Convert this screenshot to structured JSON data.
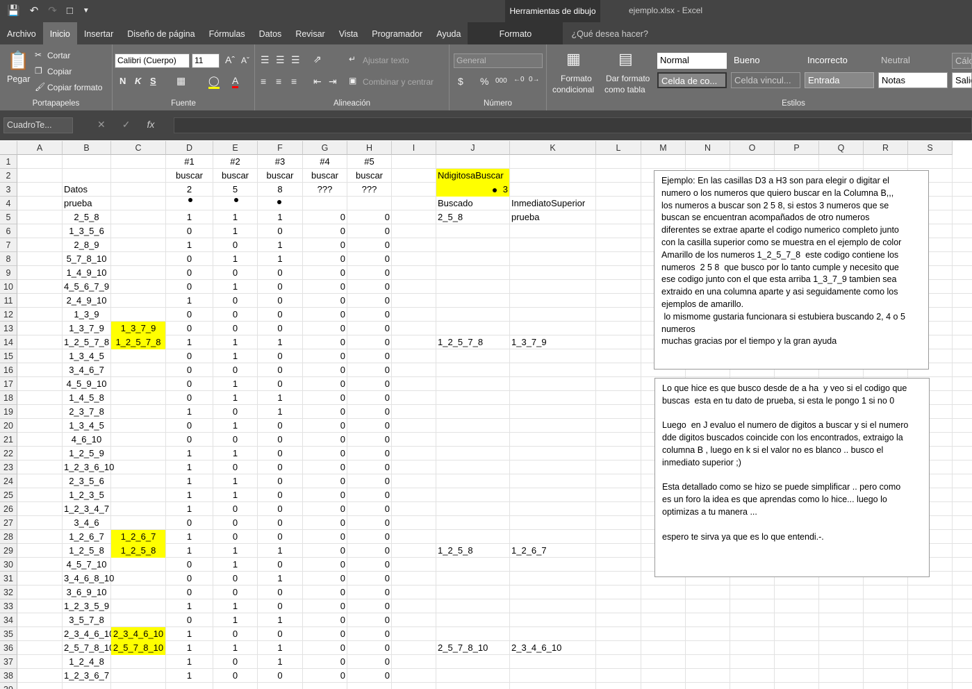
{
  "titlebar": {
    "context_tab": "Herramientas de dibujo",
    "doc_title": "ejemplo.xlsx  -  Excel"
  },
  "tabs": [
    "Archivo",
    "Inicio",
    "Insertar",
    "Diseño de página",
    "Fórmulas",
    "Datos",
    "Revisar",
    "Vista",
    "Programador",
    "Ayuda"
  ],
  "format_tab": "Formato",
  "tellme": "¿Qué desea hacer?",
  "ribbon": {
    "clipboard": {
      "paste": "Pegar",
      "cut": "Cortar",
      "copy": "Copiar",
      "format_painter": "Copiar formato",
      "label": "Portapapeles"
    },
    "font": {
      "name": "Calibri (Cuerpo)",
      "size": "11",
      "bold": "N",
      "italic": "K",
      "underline": "S",
      "label": "Fuente"
    },
    "alignment": {
      "wrap": "Ajustar texto",
      "merge": "Combinar y centrar",
      "label": "Alineación"
    },
    "number": {
      "format": "General",
      "currency": "$",
      "percent": "%",
      "thousands": "000",
      "label": "Número"
    },
    "styles": {
      "cond_format": [
        "Formato",
        "condicional"
      ],
      "table_format": [
        "Dar formato",
        "como tabla"
      ],
      "cells_row1": [
        "Normal",
        "Bueno",
        "Incorrecto",
        "Neutral",
        "Cálc"
      ],
      "cells_row2": [
        "Celda de co...",
        "Celda vincul...",
        "Entrada",
        "Notas",
        "Salid"
      ],
      "label": "Estilos"
    }
  },
  "formula_bar": {
    "name_box": "CuadroTe...",
    "fx": "fx"
  },
  "columns": [
    "A",
    "B",
    "C",
    "D",
    "E",
    "F",
    "G",
    "H",
    "I",
    "J",
    "K",
    "L",
    "M",
    "N",
    "O",
    "P",
    "Q",
    "R",
    "S"
  ],
  "header_rows": {
    "row1": [
      "#1",
      "#2",
      "#3",
      "#4",
      "#5"
    ],
    "row2": [
      "buscar",
      "buscar",
      "buscar",
      "buscar",
      "buscar"
    ],
    "row3": [
      "2",
      "5",
      "8",
      "???",
      "???"
    ],
    "b3": "Datos",
    "b4": "prueba",
    "j2": "NdigitosaBuscar",
    "j3": "3",
    "j4": "Buscado",
    "k4": "InmediatoSuperior"
  },
  "data_rows": [
    {
      "b": "2_5_8",
      "c": "",
      "d": 1,
      "e": 1,
      "f": 1,
      "g": 0,
      "h": 0,
      "j": "2_5_8",
      "k": "prueba"
    },
    {
      "b": "1_3_5_6",
      "c": "",
      "d": 0,
      "e": 1,
      "f": 0,
      "g": 0,
      "h": 0,
      "j": "",
      "k": ""
    },
    {
      "b": "2_8_9",
      "c": "",
      "d": 1,
      "e": 0,
      "f": 1,
      "g": 0,
      "h": 0,
      "j": "",
      "k": ""
    },
    {
      "b": "5_7_8_10",
      "c": "",
      "d": 0,
      "e": 1,
      "f": 1,
      "g": 0,
      "h": 0,
      "j": "",
      "k": ""
    },
    {
      "b": "1_4_9_10",
      "c": "",
      "d": 0,
      "e": 0,
      "f": 0,
      "g": 0,
      "h": 0,
      "j": "",
      "k": ""
    },
    {
      "b": "4_5_6_7_9",
      "c": "",
      "d": 0,
      "e": 1,
      "f": 0,
      "g": 0,
      "h": 0,
      "j": "",
      "k": ""
    },
    {
      "b": "2_4_9_10",
      "c": "",
      "d": 1,
      "e": 0,
      "f": 0,
      "g": 0,
      "h": 0,
      "j": "",
      "k": ""
    },
    {
      "b": "1_3_9",
      "c": "",
      "d": 0,
      "e": 0,
      "f": 0,
      "g": 0,
      "h": 0,
      "j": "",
      "k": ""
    },
    {
      "b": "1_3_7_9",
      "c": "1_3_7_9",
      "d": 0,
      "e": 0,
      "f": 0,
      "g": 0,
      "h": 0,
      "j": "",
      "k": ""
    },
    {
      "b": "1_2_5_7_8",
      "c": "1_2_5_7_8",
      "d": 1,
      "e": 1,
      "f": 1,
      "g": 0,
      "h": 0,
      "j": "1_2_5_7_8",
      "k": "1_3_7_9"
    },
    {
      "b": "1_3_4_5",
      "c": "",
      "d": 0,
      "e": 1,
      "f": 0,
      "g": 0,
      "h": 0,
      "j": "",
      "k": ""
    },
    {
      "b": "3_4_6_7",
      "c": "",
      "d": 0,
      "e": 0,
      "f": 0,
      "g": 0,
      "h": 0,
      "j": "",
      "k": ""
    },
    {
      "b": "4_5_9_10",
      "c": "",
      "d": 0,
      "e": 1,
      "f": 0,
      "g": 0,
      "h": 0,
      "j": "",
      "k": ""
    },
    {
      "b": "1_4_5_8",
      "c": "",
      "d": 0,
      "e": 1,
      "f": 1,
      "g": 0,
      "h": 0,
      "j": "",
      "k": ""
    },
    {
      "b": "2_3_7_8",
      "c": "",
      "d": 1,
      "e": 0,
      "f": 1,
      "g": 0,
      "h": 0,
      "j": "",
      "k": ""
    },
    {
      "b": "1_3_4_5",
      "c": "",
      "d": 0,
      "e": 1,
      "f": 0,
      "g": 0,
      "h": 0,
      "j": "",
      "k": ""
    },
    {
      "b": "4_6_10",
      "c": "",
      "d": 0,
      "e": 0,
      "f": 0,
      "g": 0,
      "h": 0,
      "j": "",
      "k": ""
    },
    {
      "b": "1_2_5_9",
      "c": "",
      "d": 1,
      "e": 1,
      "f": 0,
      "g": 0,
      "h": 0,
      "j": "",
      "k": ""
    },
    {
      "b": "1_2_3_6_10",
      "c": "",
      "d": 1,
      "e": 0,
      "f": 0,
      "g": 0,
      "h": 0,
      "j": "",
      "k": ""
    },
    {
      "b": "2_3_5_6",
      "c": "",
      "d": 1,
      "e": 1,
      "f": 0,
      "g": 0,
      "h": 0,
      "j": "",
      "k": ""
    },
    {
      "b": "1_2_3_5",
      "c": "",
      "d": 1,
      "e": 1,
      "f": 0,
      "g": 0,
      "h": 0,
      "j": "",
      "k": ""
    },
    {
      "b": "1_2_3_4_7",
      "c": "",
      "d": 1,
      "e": 0,
      "f": 0,
      "g": 0,
      "h": 0,
      "j": "",
      "k": ""
    },
    {
      "b": "3_4_6",
      "c": "",
      "d": 0,
      "e": 0,
      "f": 0,
      "g": 0,
      "h": 0,
      "j": "",
      "k": ""
    },
    {
      "b": "1_2_6_7",
      "c": "1_2_6_7",
      "d": 1,
      "e": 0,
      "f": 0,
      "g": 0,
      "h": 0,
      "j": "",
      "k": ""
    },
    {
      "b": "1_2_5_8",
      "c": "1_2_5_8",
      "d": 1,
      "e": 1,
      "f": 1,
      "g": 0,
      "h": 0,
      "j": "1_2_5_8",
      "k": "1_2_6_7"
    },
    {
      "b": "4_5_7_10",
      "c": "",
      "d": 0,
      "e": 1,
      "f": 0,
      "g": 0,
      "h": 0,
      "j": "",
      "k": ""
    },
    {
      "b": "3_4_6_8_10",
      "c": "",
      "d": 0,
      "e": 0,
      "f": 1,
      "g": 0,
      "h": 0,
      "j": "",
      "k": ""
    },
    {
      "b": "3_6_9_10",
      "c": "",
      "d": 0,
      "e": 0,
      "f": 0,
      "g": 0,
      "h": 0,
      "j": "",
      "k": ""
    },
    {
      "b": "1_2_3_5_9",
      "c": "",
      "d": 1,
      "e": 1,
      "f": 0,
      "g": 0,
      "h": 0,
      "j": "",
      "k": ""
    },
    {
      "b": "3_5_7_8",
      "c": "",
      "d": 0,
      "e": 1,
      "f": 1,
      "g": 0,
      "h": 0,
      "j": "",
      "k": ""
    },
    {
      "b": "2_3_4_6_10",
      "c": "2_3_4_6_10",
      "d": 1,
      "e": 0,
      "f": 0,
      "g": 0,
      "h": 0,
      "j": "",
      "k": ""
    },
    {
      "b": "2_5_7_8_10",
      "c": "2_5_7_8_10",
      "d": 1,
      "e": 1,
      "f": 1,
      "g": 0,
      "h": 0,
      "j": "2_5_7_8_10",
      "k": "2_3_4_6_10"
    },
    {
      "b": "1_2_4_8",
      "c": "",
      "d": 1,
      "e": 0,
      "f": 1,
      "g": 0,
      "h": 0,
      "j": "",
      "k": ""
    },
    {
      "b": "1_2_3_6_7",
      "c": "",
      "d": 1,
      "e": 0,
      "f": 0,
      "g": 0,
      "h": 0,
      "j": "",
      "k": ""
    }
  ],
  "textbox1": "Ejemplo: En las casillas D3 a H3 son para elegir o digitar el\nnumero o los numeros que quiero buscar en la Columna B,,,\nlos numeros a buscar son 2 5 8, si estos 3 numeros que se\nbuscan se encuentran acompañados de otro numeros\ndiferentes se extrae aparte el codigo numerico completo junto\ncon la casilla superior como se muestra en el ejemplo de color\nAmarillo de los numeros 1_2_5_7_8  este codigo contiene los\nnumeros  2 5 8  que busco por lo tanto cumple y necesito que\nese codigo junto con el que esta arriba 1_3_7_9 tambien sea\nextraido en una columna aparte y asi seguidamente como los\nejemplos de amarillo.\n lo mismome gustaria funcionara si estubiera buscando 2, 4 o 5\nnumeros\nmuchas gracias por el tiempo y la gran ayuda",
  "textbox2": "Lo que hice es que busco desde de a ha  y veo si el codigo que\nbuscas  esta en tu dato de prueba, si esta le pongo 1 si no 0\n\nLuego  en J evaluo el numero de digitos a buscar y si el numero\ndde digitos buscados coincide con los encontrados, extraigo la\ncolumna B , luego en k si el valor no es blanco .. busco el\ninmediato superior ;)\n\nEsta detallado como se hizo se puede simplificar .. pero como\nes un foro la idea es que aprendas como lo hice... luego lo\noptimizas a tu manera ...\n\nespero te sirva ya que es lo que entendi.-.",
  "colors": {
    "highlight": "#ffff00",
    "ribbon": "#6e6e6e",
    "chrome": "#444444"
  }
}
